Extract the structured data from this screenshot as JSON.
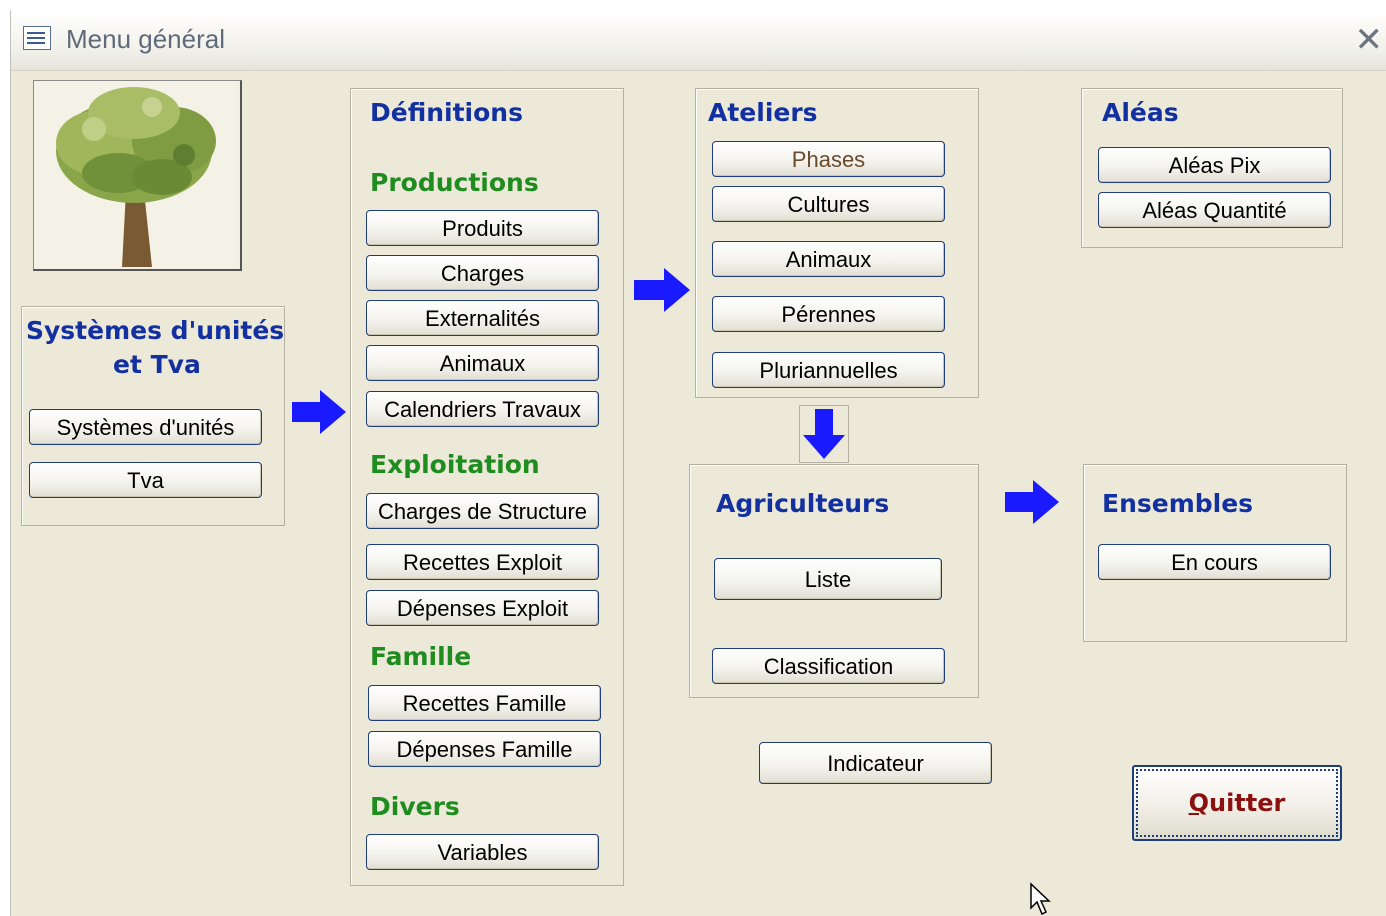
{
  "window": {
    "title": "Menu général",
    "close_symbol": "✕"
  },
  "systems": {
    "heading_line1": "Systèmes d'unités",
    "heading_line2": "et Tva",
    "buttons": [
      "Systèmes d'unités",
      "Tva"
    ]
  },
  "definitions": {
    "heading": "Définitions",
    "productions": {
      "heading": "Productions",
      "buttons": [
        "Produits",
        "Charges",
        "Externalités",
        "Animaux",
        "Calendriers Travaux"
      ]
    },
    "exploitation": {
      "heading": "Exploitation",
      "buttons": [
        "Charges de Structure",
        "Recettes Exploit",
        "Dépenses Exploit"
      ]
    },
    "famille": {
      "heading": "Famille",
      "buttons": [
        "Recettes Famille",
        "Dépenses Famille"
      ]
    },
    "divers": {
      "heading": "Divers",
      "buttons": [
        "Variables"
      ]
    }
  },
  "ateliers": {
    "heading": "Ateliers",
    "buttons": [
      "Phases",
      "Cultures",
      "Animaux",
      "Pérennes",
      "Pluriannuelles"
    ]
  },
  "aleas": {
    "heading": "Aléas",
    "buttons": [
      "Aléas Pix",
      "Aléas Quantité"
    ]
  },
  "agriculteurs": {
    "heading": "Agriculteurs",
    "buttons": [
      "Liste",
      "Classification"
    ]
  },
  "ensembles": {
    "heading": "Ensembles",
    "buttons": [
      "En cours"
    ]
  },
  "indicateur": {
    "label": "Indicateur"
  },
  "quit": {
    "underlined_letter": "Q",
    "rest": "uitter"
  },
  "colors": {
    "heading_blue": "#1230a0",
    "heading_green": "#1f8c1f",
    "arrow_blue": "#1a1aff",
    "quit_text": "#8b1010",
    "window_bg": "#ece9d8"
  },
  "icons": [
    "form-icon",
    "close-icon",
    "tree-image",
    "right-arrow-icon",
    "down-arrow-icon",
    "mouse-cursor-icon"
  ]
}
